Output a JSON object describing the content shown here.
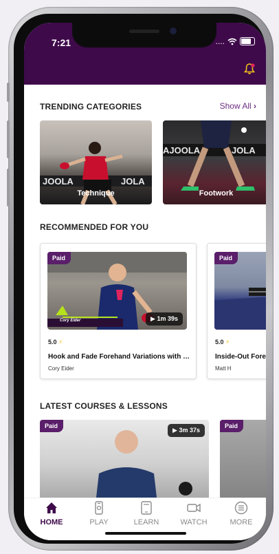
{
  "status_bar": {
    "time": "7:21",
    "signal": "...."
  },
  "header": {
    "bell_icon": "bell-icon",
    "accent": "#3e0a4a"
  },
  "trending": {
    "title": "TRENDING CATEGORIES",
    "show_all": "Show All",
    "items": [
      {
        "label": "Technique"
      },
      {
        "label": "Footwork"
      }
    ]
  },
  "recommended": {
    "title": "RECOMMENDED FOR YOU",
    "items": [
      {
        "badge": "Paid",
        "duration": "1m 39s",
        "rating": "5.0",
        "title": "Hook and Fade Forehand Variations with Cor...",
        "author": "Cory Eider",
        "video_caption": "Cory Eider"
      },
      {
        "badge": "Paid",
        "rating": "5.0",
        "title": "Inside-Out Foreh",
        "author": "Matt H"
      }
    ]
  },
  "latest": {
    "title": "LATEST COURSES & LESSONS",
    "items": [
      {
        "badge": "Paid",
        "duration": "3m 37s"
      },
      {
        "badge": "Paid"
      }
    ]
  },
  "tabbar": {
    "tabs": [
      {
        "label": "HOME",
        "icon": "home-icon"
      },
      {
        "label": "PLAY",
        "icon": "phone-icon"
      },
      {
        "label": "LEARN",
        "icon": "tablet-icon"
      },
      {
        "label": "WATCH",
        "icon": "video-icon"
      },
      {
        "label": "MORE",
        "icon": "menu-icon"
      }
    ]
  }
}
